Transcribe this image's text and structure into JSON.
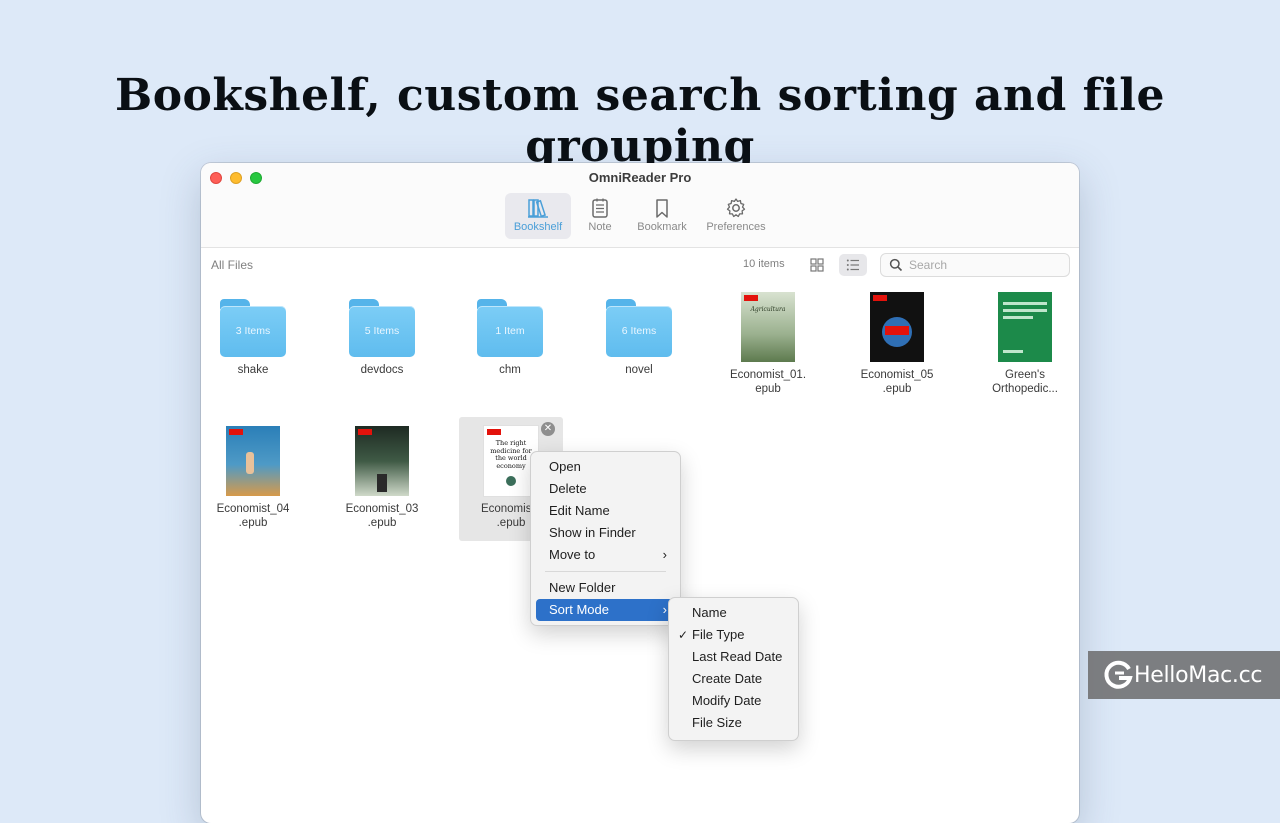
{
  "headline": "Bookshelf, custom search sorting and file grouping",
  "window": {
    "title": "OmniReader Pro"
  },
  "toolbar": {
    "items": [
      {
        "label": "Bookshelf",
        "icon": "books-icon"
      },
      {
        "label": "Note",
        "icon": "note-icon"
      },
      {
        "label": "Bookmark",
        "icon": "bookmark-icon"
      },
      {
        "label": "Preferences",
        "icon": "gear-icon"
      }
    ],
    "active": "Bookshelf",
    "accent": "#4a9fd8"
  },
  "pathbar": {
    "breadcrumb": "All Files",
    "item_count": "10 items",
    "search_placeholder": "Search",
    "view_mode": "list"
  },
  "files": [
    {
      "kind": "folder",
      "name": "shake",
      "count": "3 Items"
    },
    {
      "kind": "folder",
      "name": "devdocs",
      "count": "5 Items"
    },
    {
      "kind": "folder",
      "name": "chm",
      "count": "1 Item"
    },
    {
      "kind": "folder",
      "name": "novel",
      "count": "6 Items"
    },
    {
      "kind": "book",
      "name_line1": "Economist_01.",
      "name_line2": "epub",
      "cover_color": "#d8e2d0"
    },
    {
      "kind": "book",
      "name_line1": "Economist_05",
      "name_line2": ".epub",
      "cover_color": "#111111"
    },
    {
      "kind": "book",
      "name_line1": "Green's",
      "name_line2": "Orthopedic...",
      "cover_color": "#1c8a4a"
    },
    {
      "kind": "book",
      "name_line1": "Economist_04",
      "name_line2": ".epub",
      "cover_color": "#2b7fb8"
    },
    {
      "kind": "book",
      "name_line1": "Economist_03",
      "name_line2": ".epub",
      "cover_color": "#cfd9c9"
    },
    {
      "kind": "book",
      "name_line1": "Economist_",
      "name_line2": ".epub",
      "cover_color": "#ffffff",
      "selected": true,
      "cover_text": "The right medicine for the world economy"
    }
  ],
  "context_menu": {
    "items": [
      "Open",
      "Delete",
      "Edit Name",
      "Show in Finder",
      "Move to"
    ],
    "items2": [
      "New Folder",
      "Sort Mode"
    ],
    "highlighted": "Sort Mode",
    "highlight_color": "#2d71c9"
  },
  "sort_menu": {
    "items": [
      "Name",
      "File Type",
      "Last Read Date",
      "Create Date",
      "Modify Date",
      "File Size"
    ],
    "checked": "File Type"
  },
  "watermark": {
    "text": "HelloMac.cc"
  }
}
